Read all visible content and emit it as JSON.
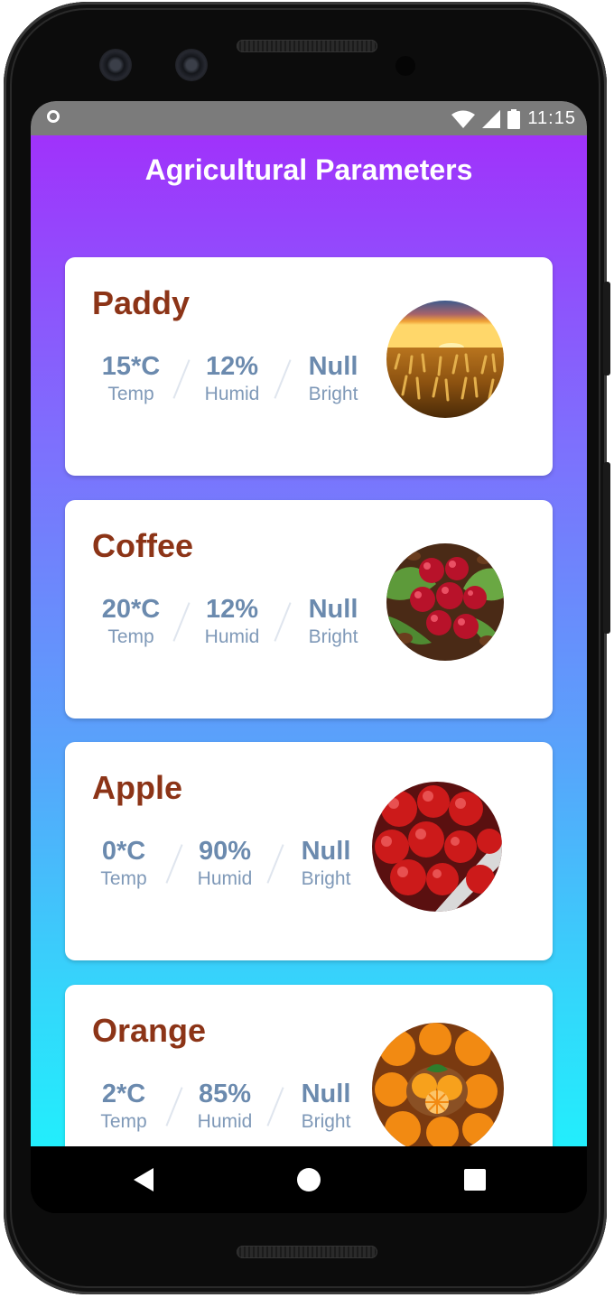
{
  "status_bar": {
    "time": "11:15",
    "icons": [
      "circle-notification-icon",
      "wifi-icon",
      "signal-icon",
      "battery-icon"
    ]
  },
  "app": {
    "title": "Agricultural Parameters",
    "colors": {
      "gradient_top": "#a032fb",
      "gradient_bottom": "#22eefc",
      "crop_name": "#8c3417",
      "value": "#6b8aae"
    }
  },
  "crops": [
    {
      "name": "Paddy",
      "temp": "15*C",
      "temp_label": "Temp",
      "humid": "12%",
      "humid_label": "Humid",
      "bright": "Null",
      "bright_label": "Bright",
      "image": "wheat-field-photo"
    },
    {
      "name": "Coffee",
      "temp": "20*C",
      "temp_label": "Temp",
      "humid": "12%",
      "humid_label": "Humid",
      "bright": "Null",
      "bright_label": "Bright",
      "image": "coffee-beans-photo"
    },
    {
      "name": "Apple",
      "temp": "0*C",
      "temp_label": "Temp",
      "humid": "90%",
      "humid_label": "Humid",
      "bright": "Null",
      "bright_label": "Bright",
      "image": "apples-photo"
    },
    {
      "name": "Orange",
      "temp": "2*C",
      "temp_label": "Temp",
      "humid": "85%",
      "humid_label": "Humid",
      "bright": "Null",
      "bright_label": "Bright",
      "image": "oranges-photo"
    }
  ],
  "nav_bar": {
    "icons": [
      "back-icon",
      "home-icon",
      "recents-icon"
    ]
  }
}
